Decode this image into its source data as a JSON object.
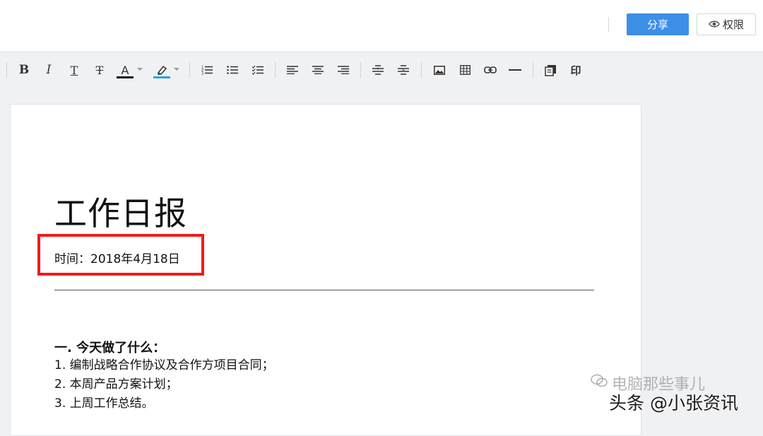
{
  "header": {
    "share_label": "分享",
    "permission_label": "权限",
    "permission_icon": "eye-icon"
  },
  "toolbar": {
    "bold": "B",
    "italic": "I",
    "text_style": "T",
    "strikethrough": "T",
    "font_color_letter": "A",
    "font_color": "#111111",
    "highlight_color": "#2aa7e0",
    "print": "印",
    "icons": [
      "bold-icon",
      "italic-icon",
      "text-style-icon",
      "strikethrough-icon",
      "font-color-icon",
      "highlight-icon",
      "ordered-list-icon",
      "unordered-list-icon",
      "checklist-icon",
      "align-left-icon",
      "align-center-icon",
      "align-right-icon",
      "indent-increase-icon",
      "indent-decrease-icon",
      "image-icon",
      "table-icon",
      "link-icon",
      "horizontal-rule-icon",
      "copy-format-icon",
      "print-icon"
    ]
  },
  "document": {
    "title": "工作日报",
    "date": "时间：2018年4月18日",
    "section_heading": "一. 今天做了什么：",
    "items": [
      "1. 编制战略合作协议及合作方项目合同；",
      "2. 本周产品方案计划；",
      "3. 上周工作总结。"
    ],
    "highlight_color": "#ee1c1c"
  },
  "watermarks": {
    "wechat": "电脑那些事儿",
    "toutiao": "头条 @小张资讯"
  }
}
